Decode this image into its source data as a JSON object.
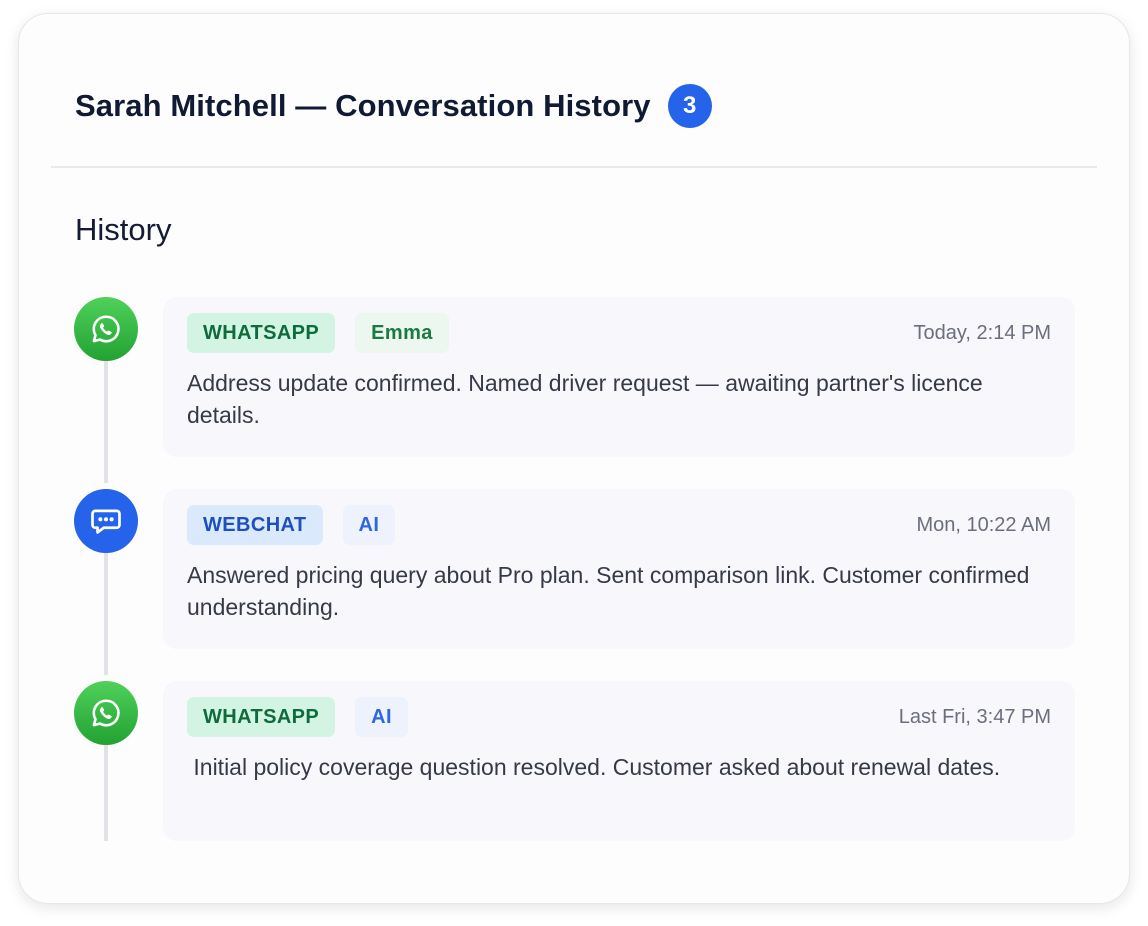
{
  "header": {
    "title": "Sarah Mitchell — Conversation History",
    "count": "3"
  },
  "section": {
    "title": "History"
  },
  "colors": {
    "accent": "#2563eb",
    "whatsapp": "#25a838",
    "webchat": "#2563eb"
  },
  "entries": [
    {
      "channel": "WHATSAPP",
      "channel_icon": "whatsapp-icon",
      "agent": "Emma",
      "timestamp": "Today, 2:14 PM",
      "summary": "Address update confirmed. Named driver request — awaiting partner's licence details."
    },
    {
      "channel": "WEBCHAT",
      "channel_icon": "chat-bubble-icon",
      "agent": "AI",
      "timestamp": "Mon, 10:22 AM",
      "summary": "Answered pricing query about Pro plan. Sent comparison link. Customer confirmed understanding."
    },
    {
      "channel": "WHATSAPP",
      "channel_icon": "whatsapp-icon",
      "agent": "AI",
      "timestamp": "Last Fri, 3:47 PM",
      "summary": " Initial policy coverage question resolved. Customer asked about renewal dates."
    }
  ]
}
